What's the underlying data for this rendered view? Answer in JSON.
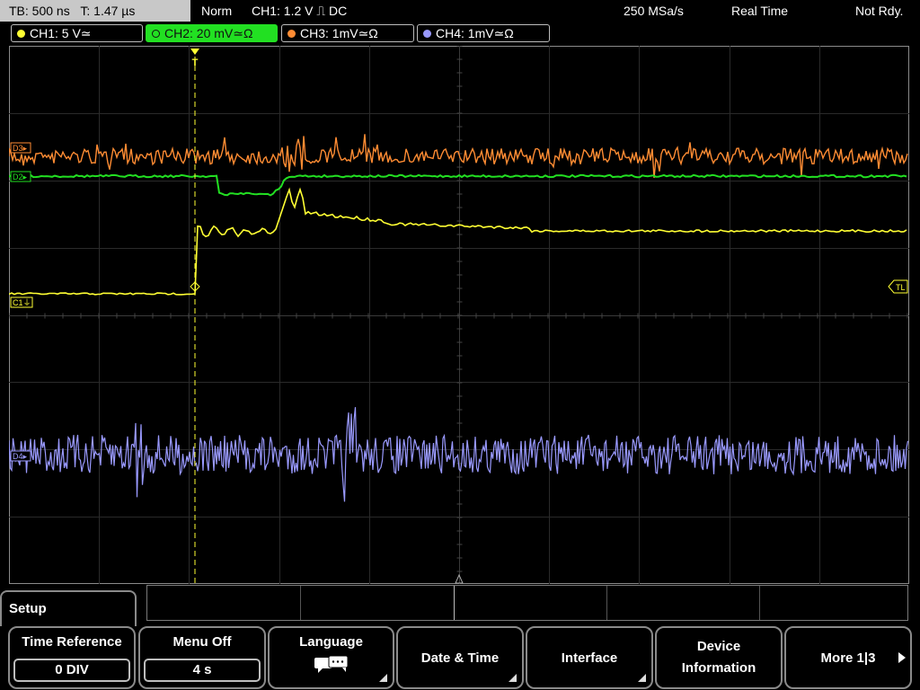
{
  "status": {
    "timebase": "TB: 500 ns",
    "trigger_time": "T: 1.47 µs",
    "trigger_mode": "Norm",
    "trigger_source": "CH1: 1.2 V ⎍ DC",
    "sample_rate": "250 MSa/s",
    "acq_mode": "Real Time",
    "state": "Not Rdy."
  },
  "channels": [
    {
      "label": "CH1: 5 V≃",
      "color": "#ffff33"
    },
    {
      "label": "CH2: 20 mV≃Ω",
      "color": "#22e022"
    },
    {
      "label": "CH3: 1mV≃Ω",
      "color": "#ff8c33"
    },
    {
      "label": "CH4: 1mV≃Ω",
      "color": "#9a9aff"
    }
  ],
  "markers": {
    "ch3": "D3▸",
    "ch2": "D2▸",
    "ch1": "C1⏚",
    "ch4": "D4▸",
    "trigger_level": "TL",
    "trigger_pos": "T"
  },
  "menu": {
    "title": "Setup",
    "softkeys": [
      {
        "label": "Time Reference",
        "value": "0 DIV"
      },
      {
        "label": "Menu Off",
        "value": "4 s"
      },
      {
        "label": "Language",
        "icon": "speech-bubble-icon"
      },
      {
        "label": "Date & Time"
      },
      {
        "label": "Interface"
      },
      {
        "label1": "Device",
        "label2": "Information"
      },
      {
        "label": "More 1|3"
      }
    ]
  }
}
